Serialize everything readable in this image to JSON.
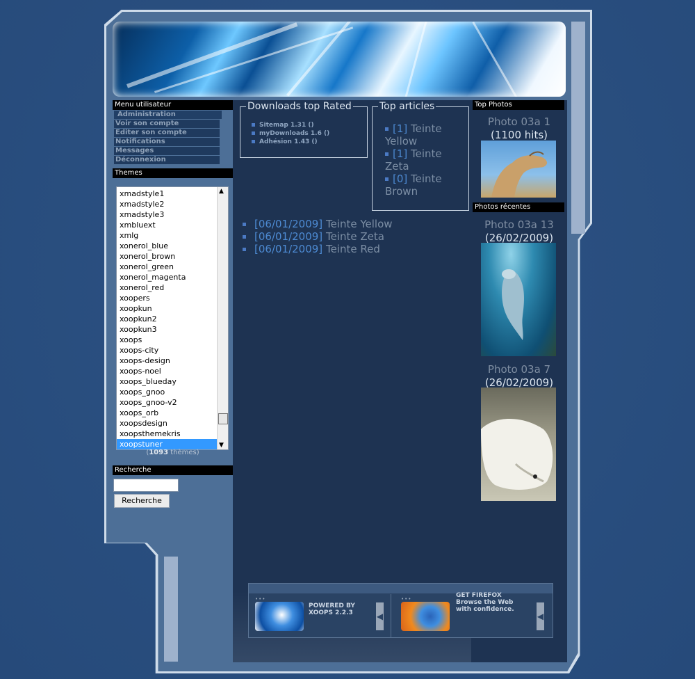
{
  "user_menu": {
    "title": "Menu utilisateur",
    "items": [
      {
        "label": "Administration"
      },
      {
        "label": "Voir son compte"
      },
      {
        "label": "Editer son compte"
      },
      {
        "label": "Notifications"
      },
      {
        "label": "Messages"
      },
      {
        "label": "Déconnexion"
      }
    ]
  },
  "themes": {
    "title": "Themes",
    "items": [
      "xmadstyle1",
      "xmadstyle2",
      "xmadstyle3",
      "xmbluext",
      "xmlg",
      "xonerol_blue",
      "xonerol_brown",
      "xonerol_green",
      "xonerol_magenta",
      "xonerol_red",
      "xoopers",
      "xoopkun",
      "xoopkun2",
      "xoopkun3",
      "xoops",
      "xoops-city",
      "xoops-design",
      "xoops-noel",
      "xoops_blueday",
      "xoops_gnoo",
      "xoops_gnoo-v2",
      "xoops_orb",
      "xoopsdesign",
      "xoopsthemekris",
      "xoopstuner"
    ],
    "selected": "xoopstuner",
    "count_open": "(",
    "count": "1093",
    "count_suffix": " thèmes)"
  },
  "search": {
    "title": "Recherche",
    "button_label": "Recherche",
    "input_value": ""
  },
  "downloads_block": {
    "title": "Downloads top Rated",
    "items": [
      "Sitemap 1.31 ()",
      "myDownloads 1.6 ()",
      "Adhésion 1.43 ()"
    ]
  },
  "articles_block": {
    "title": "Top articles",
    "items": [
      {
        "count": "[1]",
        "name": "Teinte Yellow"
      },
      {
        "count": "[1]",
        "name": "Teinte Zeta"
      },
      {
        "count": "[0]",
        "name": "Teinte Brown"
      }
    ]
  },
  "news": [
    {
      "date": "[06/01/2009]",
      "title": "Teinte Yellow"
    },
    {
      "date": "[06/01/2009]",
      "title": "Teinte Zeta"
    },
    {
      "date": "[06/01/2009]",
      "title": "Teinte Red"
    }
  ],
  "top_photos": {
    "title": "Top Photos",
    "name": "Photo 03a 1",
    "hits": "(1100 hits)"
  },
  "recent_photos": {
    "title": "Photos récentes",
    "items": [
      {
        "name": "Photo 03a 13",
        "date": "(26/02/2009)"
      },
      {
        "name": "Photo 03a 7",
        "date": "(26/02/2009)"
      }
    ]
  },
  "footer": {
    "xoops_line1": "POWERED BY",
    "xoops_line2": "XOOPS 2.2.3",
    "firefox_line1": "GET FIREFOX",
    "firefox_line2": "Browse the Web",
    "firefox_line3": "with confidence."
  },
  "colors": {
    "background": "#2c5284",
    "panel": "#1e3352",
    "link_blue": "#4d8ad2",
    "muted_text": "#7c8ea4",
    "selected": "#3399ff"
  }
}
